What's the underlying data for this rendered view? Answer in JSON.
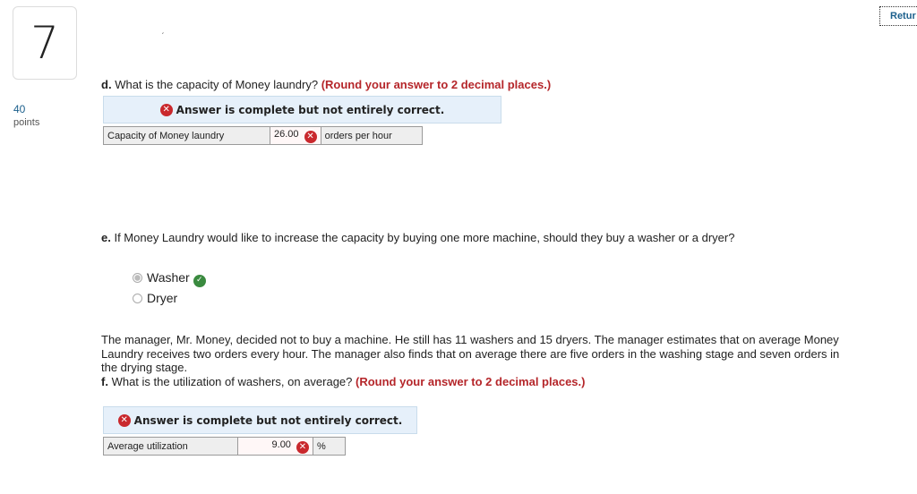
{
  "question": {
    "number": "7",
    "points_value": "40",
    "points_label": "points"
  },
  "header": {
    "return_label": "Retur",
    "tick_mark": "ˏ"
  },
  "part_d": {
    "letter": "d.",
    "text": "What is the capacity of Money laundry?",
    "instruction": "(Round your answer to 2 decimal places.)",
    "banner": "Answer is complete but not entirely correct.",
    "row": {
      "label": "Capacity of Money laundry",
      "value": "26.00",
      "unit": "orders per hour"
    }
  },
  "part_e": {
    "letter": "e.",
    "text": "If Money Laundry would like to increase the capacity by buying one more machine, should they buy a washer or a dryer?",
    "options": [
      {
        "label": "Washer",
        "selected": true,
        "correct": true
      },
      {
        "label": "Dryer",
        "selected": false
      }
    ]
  },
  "part_f": {
    "paragraph": "The manager, Mr. Money, decided not to buy a machine. He still has 11 washers and 15 dryers. The manager estimates that on average Money Laundry receives two orders every hour. The manager also finds that on average there are five orders in the washing stage and seven orders in the drying stage.",
    "letter": "f.",
    "text": "What is the utilization of washers, on average?",
    "instruction": "(Round your answer to 2 decimal places.)",
    "banner": "Answer is complete but not entirely correct.",
    "row": {
      "label": "Average utilization",
      "value": "9.00",
      "unit": "%"
    }
  },
  "colors": {
    "incorrect": "#c9282d",
    "correct": "#3a8a3f",
    "instruction": "#b5262a",
    "banner_bg": "#e6f0fa"
  },
  "icons": {
    "incorrect": "x-circle-icon",
    "correct": "check-circle-icon"
  }
}
